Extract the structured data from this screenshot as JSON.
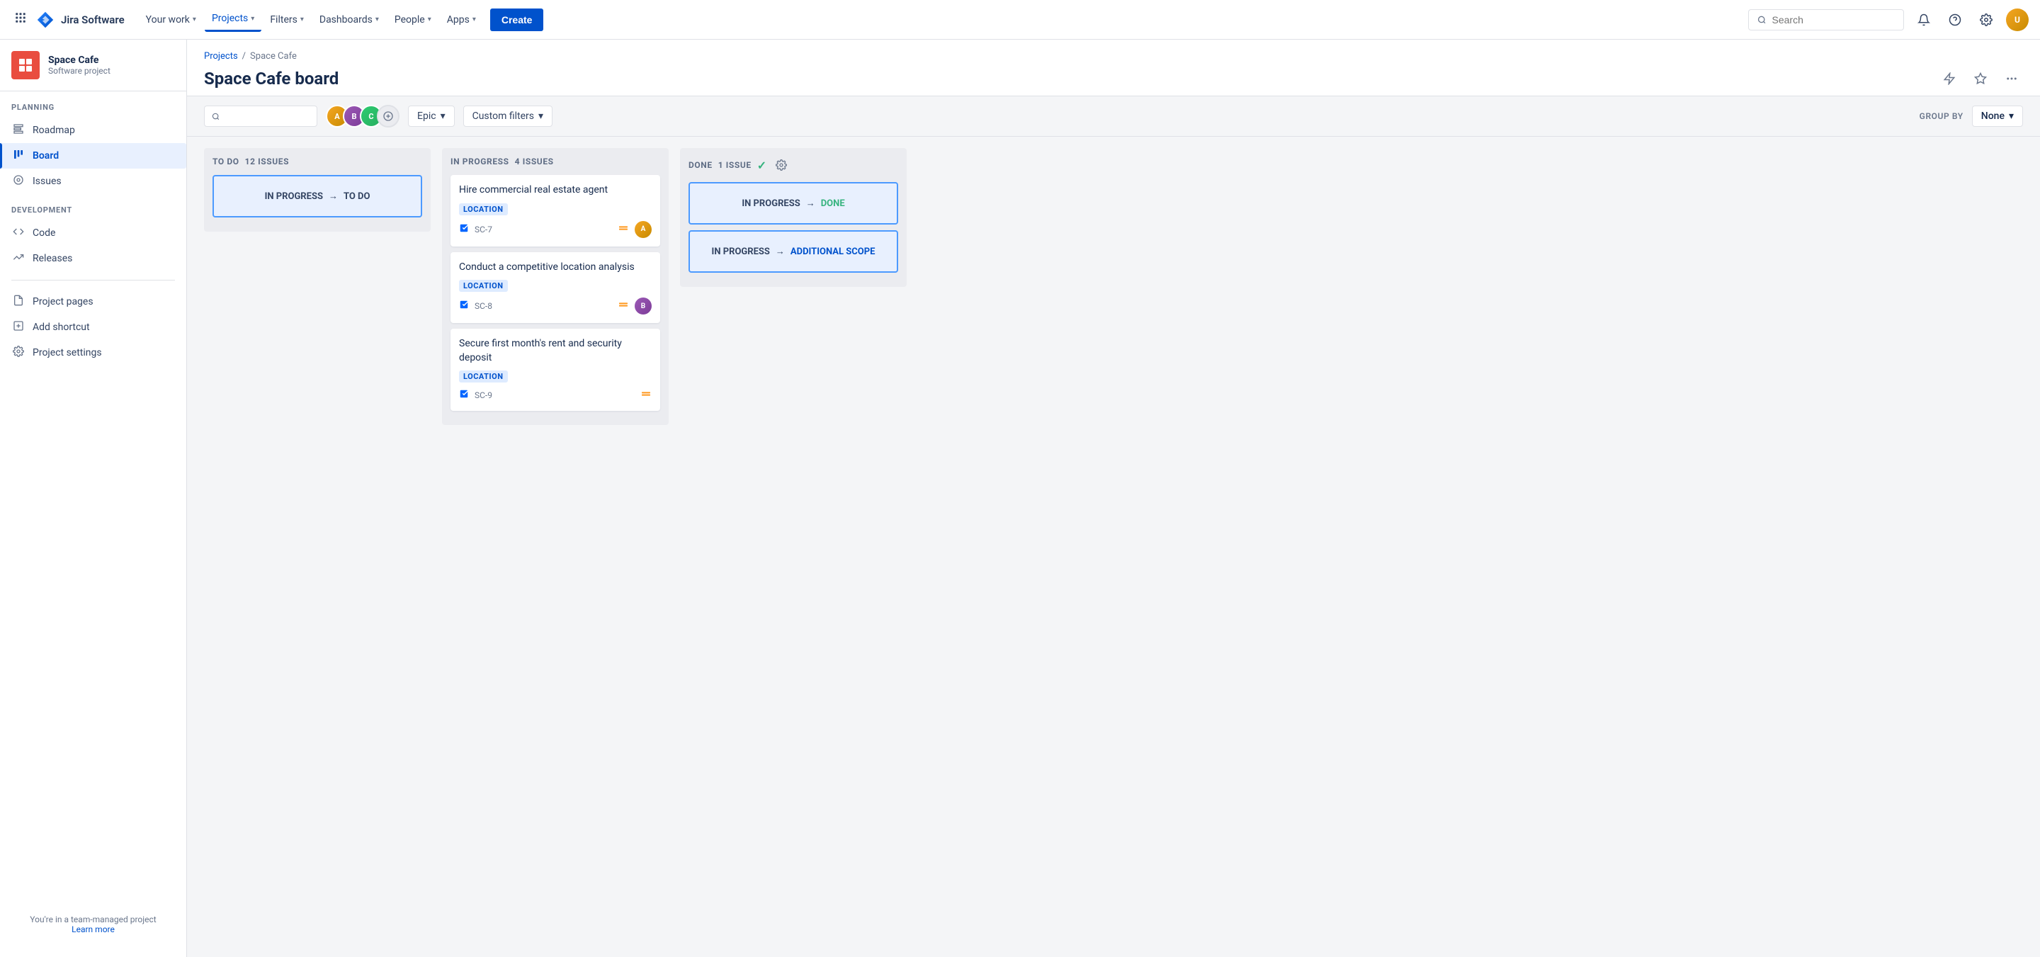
{
  "topnav": {
    "logo_text": "Jira Software",
    "nav_items": [
      {
        "label": "Your work",
        "has_chevron": true,
        "active": false
      },
      {
        "label": "Projects",
        "has_chevron": true,
        "active": true
      },
      {
        "label": "Filters",
        "has_chevron": true,
        "active": false
      },
      {
        "label": "Dashboards",
        "has_chevron": true,
        "active": false
      },
      {
        "label": "People",
        "has_chevron": true,
        "active": false
      },
      {
        "label": "Apps",
        "has_chevron": true,
        "active": false
      }
    ],
    "create_label": "Create",
    "search_placeholder": "Search"
  },
  "sidebar": {
    "project_name": "Space Cafe",
    "project_type": "Software project",
    "sections": [
      {
        "label": "PLANNING",
        "items": [
          {
            "label": "Roadmap",
            "icon": "roadmap"
          },
          {
            "label": "Board",
            "icon": "board",
            "active": true
          },
          {
            "label": "Issues",
            "icon": "issues"
          }
        ]
      },
      {
        "label": "DEVELOPMENT",
        "items": [
          {
            "label": "Code",
            "icon": "code"
          },
          {
            "label": "Releases",
            "icon": "releases"
          }
        ]
      }
    ],
    "extra_items": [
      {
        "label": "Project pages",
        "icon": "pages"
      },
      {
        "label": "Add shortcut",
        "icon": "shortcut"
      },
      {
        "label": "Project settings",
        "icon": "settings"
      }
    ],
    "footer_text": "You're in a team-managed project",
    "footer_link": "Learn more"
  },
  "board": {
    "breadcrumb": [
      "Projects",
      "Space Cafe"
    ],
    "title": "Space Cafe board",
    "columns": [
      {
        "id": "todo",
        "label": "TO DO",
        "count": "12 ISSUES",
        "cards": [],
        "transition": {
          "from": "IN PROGRESS",
          "arrow": "→",
          "to": "TO DO"
        }
      },
      {
        "id": "inprogress",
        "label": "IN PROGRESS",
        "count": "4 ISSUES",
        "cards": [
          {
            "title": "Hire commercial real estate agent",
            "label": "LOCATION",
            "issue_id": "SC-7",
            "priority": "medium",
            "has_avatar": true
          },
          {
            "title": "Conduct a competitive location analysis",
            "label": "LOCATION",
            "issue_id": "SC-8",
            "priority": "medium",
            "has_avatar": true
          },
          {
            "title": "Secure first month's rent and security deposit",
            "label": "LOCATION",
            "issue_id": "SC-9",
            "priority": "medium",
            "has_avatar": false
          }
        ]
      },
      {
        "id": "done",
        "label": "DONE",
        "count": "1 ISSUE",
        "has_check": true,
        "transitions": [
          {
            "from": "IN PROGRESS",
            "arrow": "→",
            "to": "DONE",
            "to_style": "done"
          },
          {
            "from": "IN PROGRESS",
            "arrow": "→",
            "to": "ADDITIONAL SCOPE",
            "to_style": "scope"
          }
        ]
      }
    ],
    "toolbar": {
      "epic_label": "Epic",
      "custom_filters_label": "Custom filters",
      "group_by_label": "GROUP BY",
      "group_by_value": "None"
    }
  }
}
